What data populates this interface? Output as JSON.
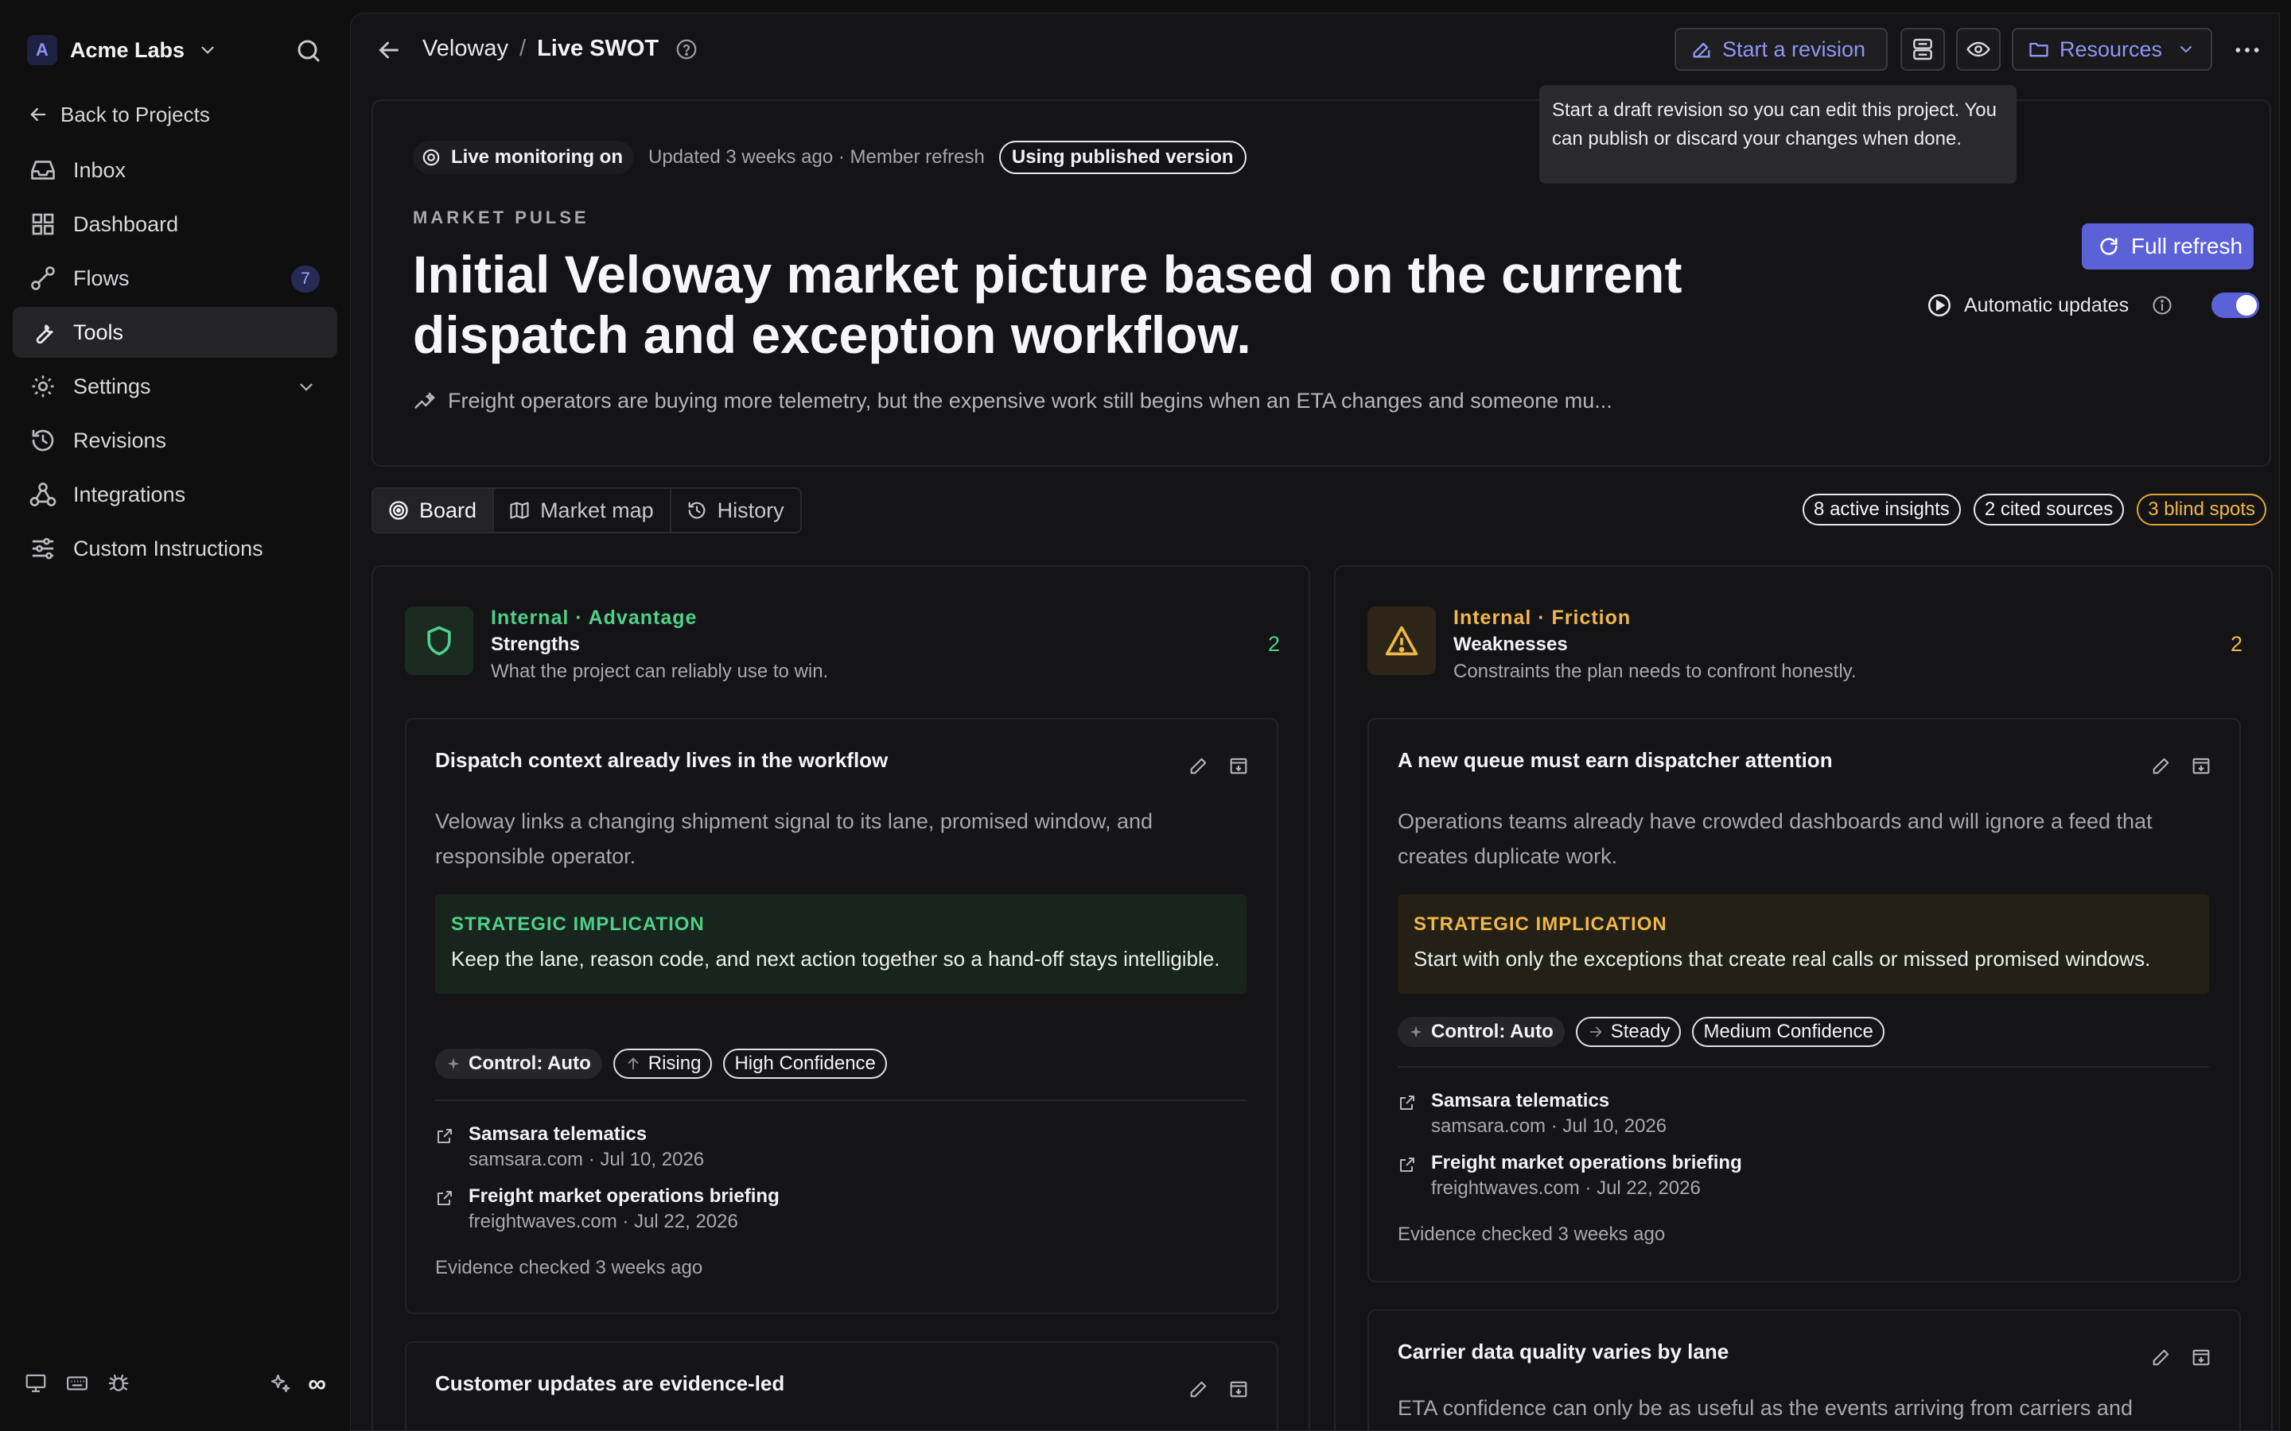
{
  "sidebar": {
    "org_initial": "A",
    "org_name": "Acme Labs",
    "back_label": "Back to Projects",
    "items": [
      {
        "label": "Inbox"
      },
      {
        "label": "Dashboard"
      },
      {
        "label": "Flows",
        "badge": "7"
      },
      {
        "label": "Tools"
      },
      {
        "label": "Settings"
      },
      {
        "label": "Revisions"
      },
      {
        "label": "Integrations"
      },
      {
        "label": "Custom Instructions"
      }
    ],
    "footer_infinity": "∞"
  },
  "topbar": {
    "crumb_project": "Veloway",
    "crumb_sep": "/",
    "crumb_page": "Live SWOT",
    "revision_label": "Start a revision",
    "resources_label": "Resources",
    "tooltip": "Start a draft revision so you can edit this project. You can publish or discard your changes when done."
  },
  "hero": {
    "live_label": "Live monitoring on",
    "updated_text": "Updated 3 weeks ago · Member refresh",
    "version_pill": "Using published version",
    "eyebrow": "MARKET PULSE",
    "title": "Initial Veloway market picture based on the current dispatch and exception workflow.",
    "summary": "Freight operators are buying more telemetry, but the expensive work still begins when an ETA changes and someone mu...",
    "full_refresh_label": "Full refresh",
    "auto_updates_label": "Automatic updates",
    "auto_updates_on": true
  },
  "tabs": [
    {
      "label": "Board"
    },
    {
      "label": "Market map"
    },
    {
      "label": "History"
    }
  ],
  "counts": {
    "insights": "8 active insights",
    "sources": "2 cited sources",
    "blind_spots": "3 blind spots"
  },
  "strengths": {
    "kicker": "Internal · Advantage",
    "title": "Strengths",
    "desc": "What the project can reliably use to win.",
    "count": "2",
    "cards": [
      {
        "title": "Dispatch context already lives in the workflow",
        "body": "Veloway links a changing shipment signal to its lane, promised window, and responsible operator.",
        "impl_label": "STRATEGIC IMPLICATION",
        "impl_text": "Keep the lane, reason code, and next action together so a hand-off stays intelligible.",
        "chips": [
          "Control: Auto",
          "Rising",
          "High Confidence"
        ],
        "sources": [
          {
            "name": "Samsara telematics",
            "meta": "samsara.com · Jul 10, 2026"
          },
          {
            "name": "Freight market operations briefing",
            "meta": "freightwaves.com · Jul 22, 2026"
          }
        ],
        "evidence": "Evidence checked 3 weeks ago"
      },
      {
        "title": "Customer updates are evidence-led"
      }
    ]
  },
  "weaknesses": {
    "kicker": "Internal · Friction",
    "title": "Weaknesses",
    "desc": "Constraints the plan needs to confront honestly.",
    "count": "2",
    "cards": [
      {
        "title": "A new queue must earn dispatcher attention",
        "body": "Operations teams already have crowded dashboards and will ignore a feed that creates duplicate work.",
        "impl_label": "STRATEGIC IMPLICATION",
        "impl_text": "Start with only the exceptions that create real calls or missed promised windows.",
        "chips": [
          "Control: Auto",
          "Steady",
          "Medium Confidence"
        ],
        "sources": [
          {
            "name": "Samsara telematics",
            "meta": "samsara.com · Jul 10, 2026"
          },
          {
            "name": "Freight market operations briefing",
            "meta": "freightwaves.com · Jul 22, 2026"
          }
        ],
        "evidence": "Evidence checked 3 weeks ago"
      },
      {
        "title": "Carrier data quality varies by lane",
        "body": "ETA confidence can only be as useful as the events arriving from carriers and"
      }
    ]
  },
  "colors": {
    "accent": "#5b62d8",
    "accent_text": "#8f95f4",
    "strength": "#4fd08a",
    "weakness": "#f0b74a"
  }
}
